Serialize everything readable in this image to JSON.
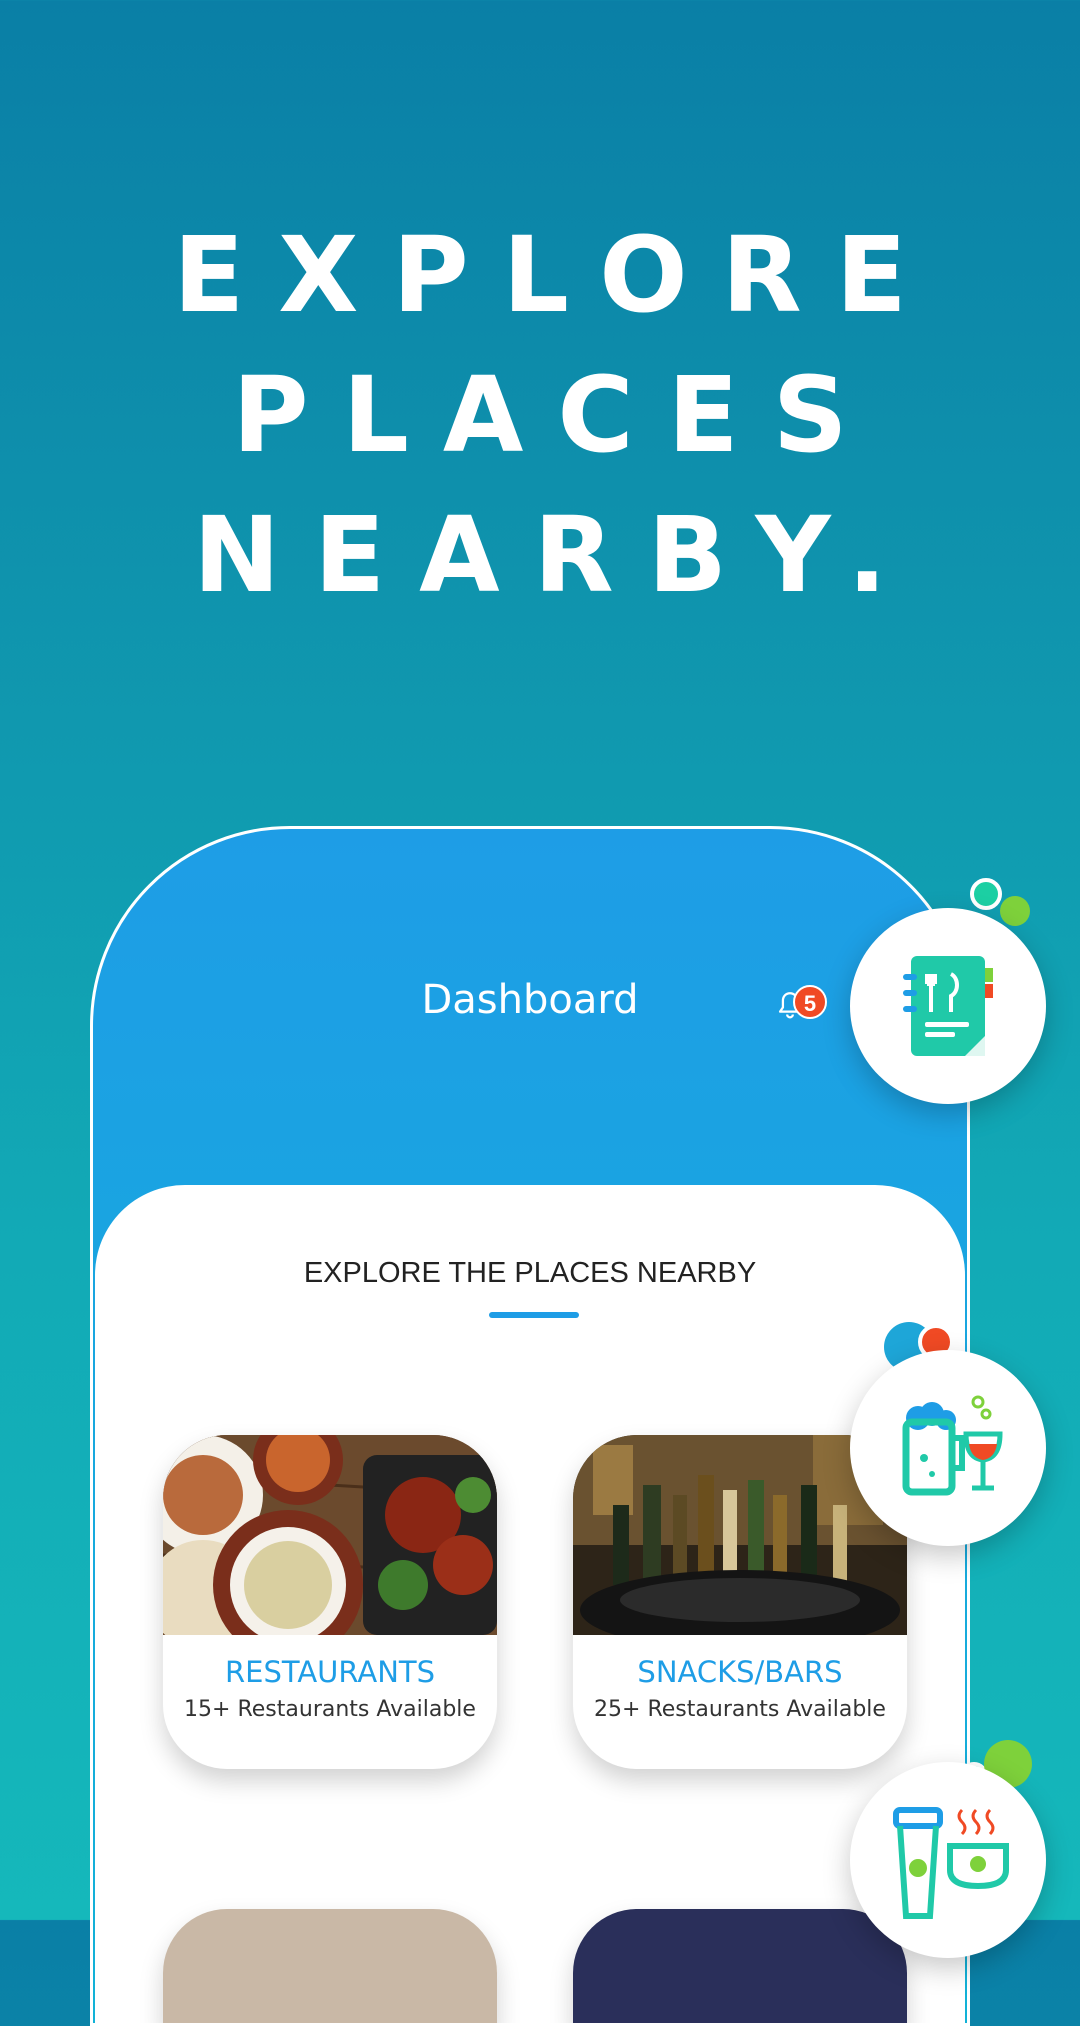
{
  "headline": {
    "line1": "EXPLORE",
    "line2": "PLACES",
    "line3": "NEARBY."
  },
  "app": {
    "title": "Dashboard",
    "notifications": {
      "count": "5",
      "icon": "bell-icon"
    }
  },
  "section": {
    "title": "EXPLORE THE PLACES NEARBY"
  },
  "categories": [
    {
      "name": "RESTAURANTS",
      "subtitle": "15+ Restaurants Available"
    },
    {
      "name": "SNACKS/BARS",
      "subtitle": "25+ Restaurants Available"
    }
  ],
  "floating_icons": [
    "menu-book-icon",
    "beer-wine-icon",
    "coffee-icon"
  ],
  "colors": {
    "accent": "#1e9de6",
    "badge": "#f04a24",
    "green": "#7ed13b",
    "teal": "#20c9a8"
  }
}
